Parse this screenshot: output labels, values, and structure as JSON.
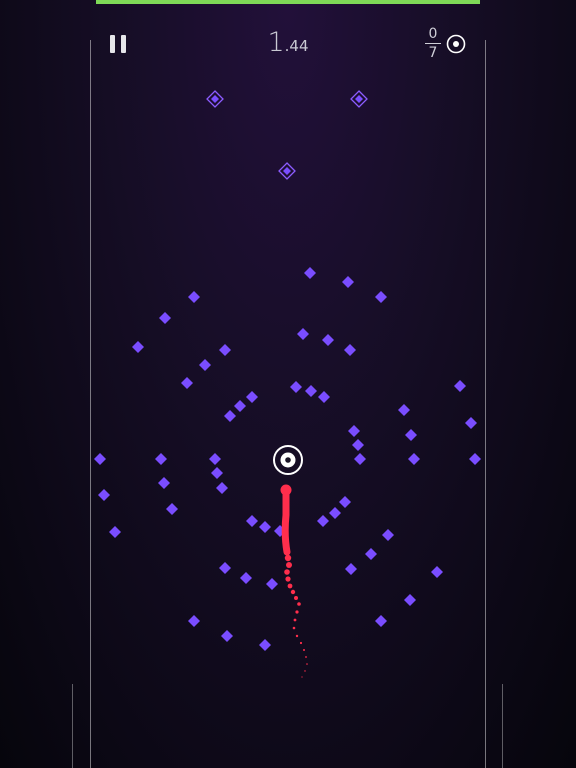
{
  "hud": {
    "timer_seconds": "1",
    "timer_fraction": ".44",
    "targets_collected": "0",
    "targets_total": "7",
    "pause_icon": "pause-icon",
    "target_icon": "target-icon",
    "level_progress": 1.0
  },
  "colors": {
    "background": "#0d0916",
    "gem": "#7a4dff",
    "gem_outline": "#8c5cff",
    "trail": "#ff2e4c",
    "progress": "#7ed957",
    "target": "#ffffff"
  },
  "board": {
    "outlined_gems": 3,
    "solid_gems": 64,
    "goal_rings": 1,
    "player": "red-worm"
  }
}
